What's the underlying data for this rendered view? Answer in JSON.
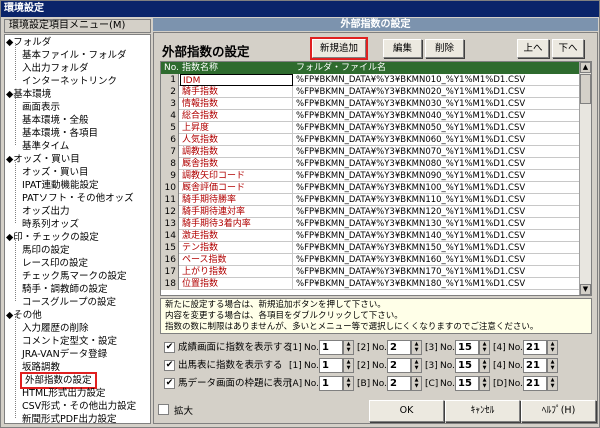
{
  "window": {
    "title": "環境設定"
  },
  "sidebar": {
    "header": "環境設定項目メニュー(M)",
    "items": [
      {
        "label": "◆フォルダ",
        "level": 0
      },
      {
        "label": "基本ファイル・フォルダ",
        "level": 1
      },
      {
        "label": "入出力フォルダ",
        "level": 1
      },
      {
        "label": "インターネットリンク",
        "level": 1
      },
      {
        "label": "◆基本環境",
        "level": 0
      },
      {
        "label": "画面表示",
        "level": 1
      },
      {
        "label": "基本環境・全般",
        "level": 1
      },
      {
        "label": "基本環境・各項目",
        "level": 1
      },
      {
        "label": "基準タイム",
        "level": 1
      },
      {
        "label": "◆オッズ・買い目",
        "level": 0
      },
      {
        "label": "オッズ・買い目",
        "level": 1
      },
      {
        "label": "IPAT連動機能設定",
        "level": 1
      },
      {
        "label": "PATソフト・その他オッズ",
        "level": 1
      },
      {
        "label": "オッズ出力",
        "level": 1
      },
      {
        "label": "時系列オッズ",
        "level": 1
      },
      {
        "label": "◆印・チェックの設定",
        "level": 0
      },
      {
        "label": "馬印の設定",
        "level": 1
      },
      {
        "label": "レース印の設定",
        "level": 1
      },
      {
        "label": "チェック馬マークの設定",
        "level": 1
      },
      {
        "label": "騎手・調教師の設定",
        "level": 1
      },
      {
        "label": "コースグループの設定",
        "level": 1
      },
      {
        "label": "◆その他",
        "level": 0
      },
      {
        "label": "入力履歴の削除",
        "level": 1
      },
      {
        "label": "コメント定型文・設定",
        "level": 1
      },
      {
        "label": "JRA-VANデータ登録",
        "level": 1
      },
      {
        "label": "坂路調教",
        "level": 1
      },
      {
        "label": "外部指数の設定",
        "level": 1,
        "selected": true
      },
      {
        "label": "HTML形式出力設定",
        "level": 1
      },
      {
        "label": "CSV形式・その他出力設定",
        "level": 1
      },
      {
        "label": "新聞形式PDF出力設定",
        "level": 1
      }
    ]
  },
  "main": {
    "header": "外部指数の設定",
    "title": "外部指数の設定",
    "buttons": {
      "add": "新規追加",
      "edit": "編集",
      "delete": "削除",
      "up": "上へ",
      "down": "下へ"
    },
    "table": {
      "columns": [
        "No.",
        "指数名称",
        "フォルダ・ファイル名"
      ],
      "rows": [
        {
          "no": "1",
          "name": "IDM",
          "path": "%FP¥BKMN_DATA¥%Y3¥BKMN010_%Y1%M1%D1.CSV"
        },
        {
          "no": "2",
          "name": "騎手指数",
          "path": "%FP¥BKMN_DATA¥%Y3¥BKMN020_%Y1%M1%D1.CSV"
        },
        {
          "no": "3",
          "name": "情報指数",
          "path": "%FP¥BKMN_DATA¥%Y3¥BKMN030_%Y1%M1%D1.CSV"
        },
        {
          "no": "4",
          "name": "総合指数",
          "path": "%FP¥BKMN_DATA¥%Y3¥BKMN040_%Y1%M1%D1.CSV"
        },
        {
          "no": "5",
          "name": "上昇度",
          "path": "%FP¥BKMN_DATA¥%Y3¥BKMN050_%Y1%M1%D1.CSV"
        },
        {
          "no": "6",
          "name": "人気指数",
          "path": "%FP¥BKMN_DATA¥%Y3¥BKMN060_%Y1%M1%D1.CSV"
        },
        {
          "no": "7",
          "name": "調教指数",
          "path": "%FP¥BKMN_DATA¥%Y3¥BKMN070_%Y1%M1%D1.CSV"
        },
        {
          "no": "8",
          "name": "厩舎指数",
          "path": "%FP¥BKMN_DATA¥%Y3¥BKMN080_%Y1%M1%D1.CSV"
        },
        {
          "no": "9",
          "name": "調教矢印コード",
          "path": "%FP¥BKMN_DATA¥%Y3¥BKMN090_%Y1%M1%D1.CSV"
        },
        {
          "no": "10",
          "name": "厩舎評価コード",
          "path": "%FP¥BKMN_DATA¥%Y3¥BKMN100_%Y1%M1%D1.CSV"
        },
        {
          "no": "11",
          "name": "騎手期待勝率",
          "path": "%FP¥BKMN_DATA¥%Y3¥BKMN110_%Y1%M1%D1.CSV"
        },
        {
          "no": "12",
          "name": "騎手期待連対率",
          "path": "%FP¥BKMN_DATA¥%Y3¥BKMN120_%Y1%M1%D1.CSV"
        },
        {
          "no": "13",
          "name": "騎手期待3着内率",
          "path": "%FP¥BKMN_DATA¥%Y3¥BKMN130_%Y1%M1%D1.CSV"
        },
        {
          "no": "14",
          "name": "激走指数",
          "path": "%FP¥BKMN_DATA¥%Y3¥BKMN140_%Y1%M1%D1.CSV"
        },
        {
          "no": "15",
          "name": "テン指数",
          "path": "%FP¥BKMN_DATA¥%Y3¥BKMN150_%Y1%M1%D1.CSV"
        },
        {
          "no": "16",
          "name": "ペース指数",
          "path": "%FP¥BKMN_DATA¥%Y3¥BKMN160_%Y1%M1%D1.CSV"
        },
        {
          "no": "17",
          "name": "上がり指数",
          "path": "%FP¥BKMN_DATA¥%Y3¥BKMN170_%Y1%M1%D1.CSV"
        },
        {
          "no": "18",
          "name": "位置指数",
          "path": "%FP¥BKMN_DATA¥%Y3¥BKMN180_%Y1%M1%D1.CSV"
        }
      ]
    },
    "notes": [
      "新たに設定する場合は、新規追加ボタンを押して下さい。",
      "内容を変更する場合は、各項目をダブルクリックして下さい。",
      "指数の数に制限はありませんが、多いとメニュー等で選択しにくくなりますのでご注意ください。"
    ],
    "options": [
      {
        "checked": true,
        "label": "成績画面に指数を表示する",
        "spins": [
          {
            "tag": "[1]",
            "no": "No.",
            "value": "1"
          },
          {
            "tag": "[2]",
            "no": "No.",
            "value": "2"
          },
          {
            "tag": "[3]",
            "no": "No.",
            "value": "15"
          },
          {
            "tag": "[4]",
            "no": "No.",
            "value": "21"
          }
        ]
      },
      {
        "checked": true,
        "label": "出馬表に指数を表示する",
        "spins": [
          {
            "tag": "[1]",
            "no": "No.",
            "value": "1"
          },
          {
            "tag": "[2]",
            "no": "No.",
            "value": "2"
          },
          {
            "tag": "[3]",
            "no": "No.",
            "value": "15"
          },
          {
            "tag": "[4]",
            "no": "No.",
            "value": "21"
          }
        ]
      },
      {
        "checked": true,
        "label": "馬データ画面の枠題に表示",
        "spins": [
          {
            "tag": "[A]",
            "no": "No.",
            "value": "1"
          },
          {
            "tag": "[B]",
            "no": "No.",
            "value": "2"
          },
          {
            "tag": "[C]",
            "no": "No.",
            "value": "15"
          },
          {
            "tag": "[D]",
            "no": "No.",
            "value": "21"
          }
        ]
      }
    ]
  },
  "footer": {
    "zoom_label": "拡大",
    "zoom_checked": false,
    "ok": "OK",
    "cancel": "ｷｬﾝｾﾙ",
    "help": "ﾍﾙﾌﾟ(H)"
  }
}
